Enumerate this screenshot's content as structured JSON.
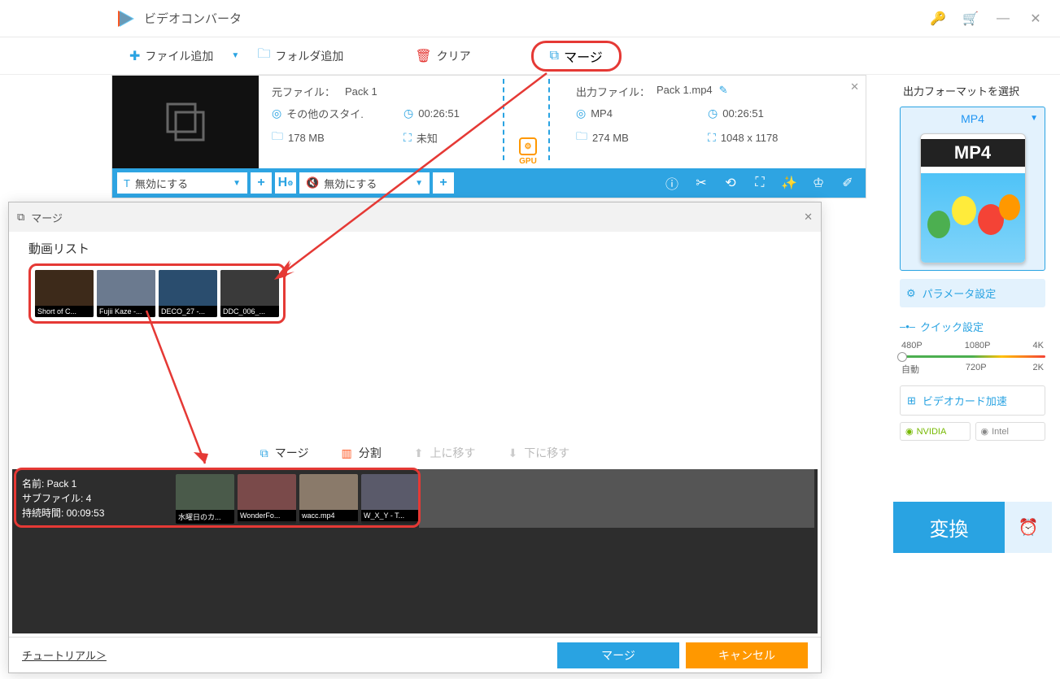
{
  "app": {
    "title": "ビデオコンバータ"
  },
  "toolbar": {
    "addFile": "ファイル追加",
    "addFolder": "フォルダ追加",
    "clear": "クリア",
    "merge": "マージ"
  },
  "file": {
    "sourceLabel": "元ファイル：",
    "sourceName": "Pack 1",
    "outputLabel": "出力ファイル：",
    "outputName": "Pack 1.mp4",
    "sourceStyle": "その他のスタイ.",
    "sourceDuration": "00:26:51",
    "sourceSize": "178 MB",
    "sourceRes": "未知",
    "outFormat": "MP4",
    "outDuration": "00:26:51",
    "outSize": "274 MB",
    "outRes": "1048 x 1178",
    "gpu": "GPU",
    "disable1": "無効にする",
    "disable2": "無効にする"
  },
  "right": {
    "selectFormat": "出力フォーマットを選択",
    "format": "MP4",
    "mp4Big": "MP4",
    "paramSetting": "パラメータ設定",
    "quickSetting": "クイック設定",
    "res": {
      "p480": "480P",
      "p1080": "1080P",
      "k4": "4K",
      "auto": "自動",
      "p720": "720P",
      "k2": "2K"
    },
    "hwAccel": "ビデオカード加速",
    "nvidia": "NVIDIA",
    "intel": "Intel",
    "convert": "変換"
  },
  "dialog": {
    "title": "マージ",
    "videoList": "動画リスト",
    "thumbs1": [
      "Short of C...",
      "Fujii Kaze -...",
      "DECO_27 -...",
      "DDC_006_..."
    ],
    "midMerge": "マージ",
    "midSplit": "分割",
    "midUp": "上に移す",
    "midDown": "下に移す",
    "packName": "名前: Pack 1",
    "packSub": "サブファイル: 4",
    "packDur": "持続時間: 00:09:53",
    "thumbs2": [
      "水曜日のカ...",
      "WonderFo...",
      "wacc.mp4",
      "W_X_Y - T..."
    ],
    "tutorial": "チュートリアル＞",
    "footMerge": "マージ",
    "footCancel": "キャンセル"
  }
}
